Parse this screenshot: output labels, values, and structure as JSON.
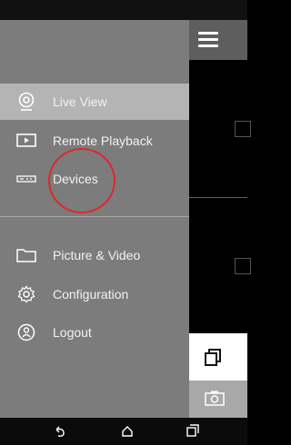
{
  "drawer": {
    "items": [
      {
        "label": "Live View",
        "icon": "camera-icon",
        "active": true
      },
      {
        "label": "Remote Playback",
        "icon": "playback-icon",
        "active": false
      },
      {
        "label": "Devices",
        "icon": "device-icon",
        "active": false
      },
      {
        "label": "Picture & Video",
        "icon": "folder-icon",
        "active": false
      },
      {
        "label": "Configuration",
        "icon": "gear-icon",
        "active": false
      },
      {
        "label": "Logout",
        "icon": "logout-icon",
        "active": false
      }
    ]
  },
  "colors": {
    "drawer_bg": "#7c7c7c",
    "active_bg": "#b4b4b4",
    "annotation": "#e0262b"
  },
  "navbar": {
    "buttons": [
      "back-icon",
      "home-icon",
      "recents-icon"
    ]
  }
}
